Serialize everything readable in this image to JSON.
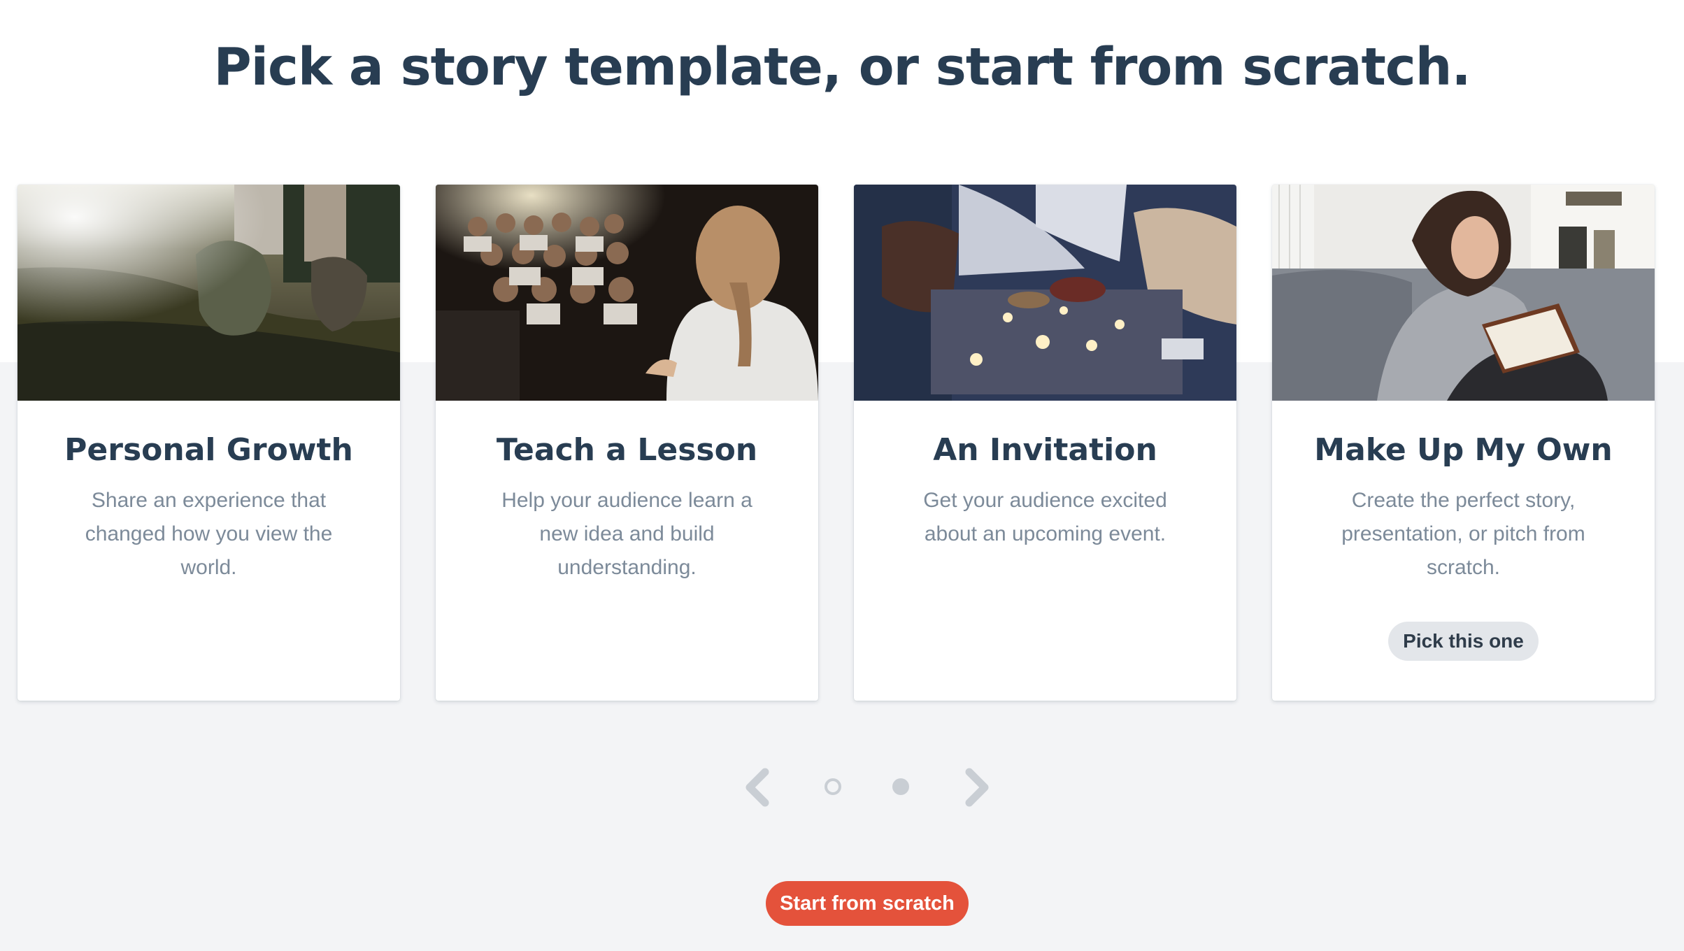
{
  "page": {
    "title": "Pick a story template, or start from scratch."
  },
  "templates": [
    {
      "title": "Personal Growth",
      "description": "Share an experience that changed how you view the world.",
      "image": "hiking-boots-trail-photo"
    },
    {
      "title": "Teach a Lesson",
      "description": "Help your audience learn a new idea and build understanding.",
      "image": "speaker-facing-audience-photo"
    },
    {
      "title": "An Invitation",
      "description": "Get your audience excited about an upcoming event.",
      "image": "candlelit-outdoor-dinner-photo"
    },
    {
      "title": "Make Up My Own",
      "description": "Create the perfect story, presentation, or pitch from scratch.",
      "image": "woman-writing-in-notebook-photo",
      "pick_label": "Pick this one",
      "hovered": true
    }
  ],
  "pager": {
    "prev_icon": "chevron-left-icon",
    "next_icon": "chevron-right-icon",
    "page_count": 2,
    "current_page": 2
  },
  "actions": {
    "start_from_scratch_label": "Start from scratch"
  },
  "colors": {
    "heading": "#283d52",
    "body_text": "#7c8a99",
    "accent": "#e4523b",
    "page_background": "#f3f4f6",
    "pager": "#c9ced4"
  }
}
